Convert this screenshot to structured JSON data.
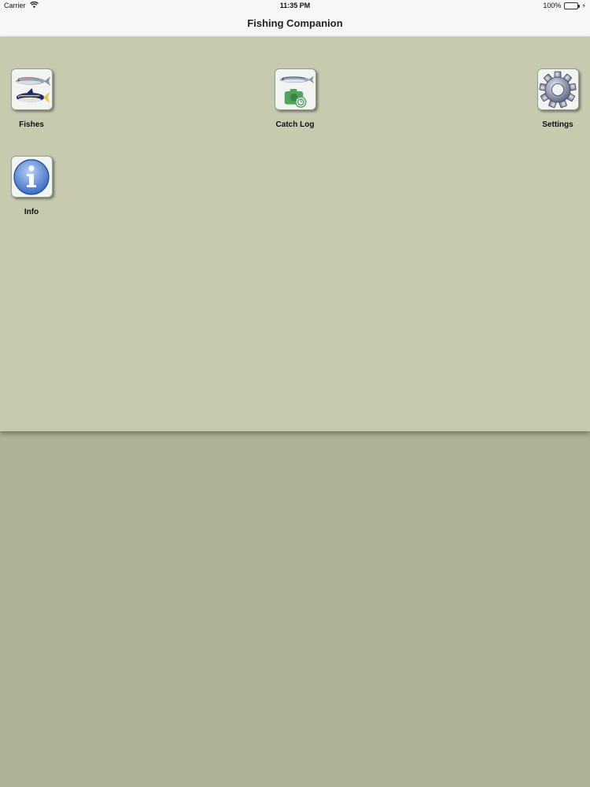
{
  "status_bar": {
    "carrier": "Carrier",
    "time": "11:35 PM",
    "battery": "100%"
  },
  "nav": {
    "title": "Fishing Companion"
  },
  "tiles": [
    {
      "label": "Fishes",
      "icon": "fishes-icon"
    },
    {
      "label": "Catch Log",
      "icon": "catch-log-icon"
    },
    {
      "label": "Settings",
      "icon": "gear-icon"
    },
    {
      "label": "Info",
      "icon": "info-icon"
    }
  ],
  "colors": {
    "panel": "#c8cab0",
    "background": "#afb298",
    "battery_fill": "#4cd964",
    "info_blue": "#3f7ad0",
    "camera_green": "#4ea65a"
  }
}
